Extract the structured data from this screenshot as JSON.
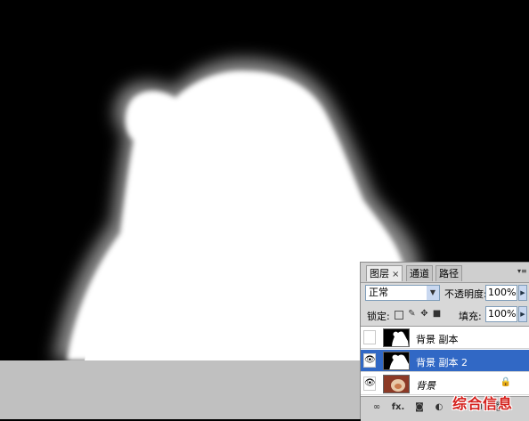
{
  "layers_panel": {
    "tabs": [
      {
        "label": "图层",
        "close": "×",
        "active": true
      },
      {
        "label": "通道",
        "active": false
      },
      {
        "label": "路径",
        "active": false
      }
    ],
    "blend_mode": "正常",
    "opacity_label": "不透明度:",
    "opacity_value": "100%",
    "lock_label": "锁定:",
    "fill_label": "填充:",
    "fill_value": "100%",
    "layers": [
      {
        "name": "背景 副本",
        "visible": false,
        "selected": false
      },
      {
        "name": "背景 副本 2",
        "visible": true,
        "selected": true
      },
      {
        "name": "背景",
        "visible": true,
        "selected": false,
        "locked": true,
        "italic": true
      }
    ]
  },
  "icons": {
    "eye": "eye-icon",
    "lock": "lock-icon",
    "link": "link-icon",
    "fx": "fx-icon",
    "mask": "mask-icon",
    "adjustment": "adjustment-icon",
    "group": "group-folder-icon",
    "new_layer": "new-layer-icon",
    "delete": "trash-icon"
  },
  "footer": {
    "fx_label": "fx."
  },
  "watermark": "综合信息",
  "colors": {
    "selected_row": "#3168c5",
    "canvas_bg": "#000000",
    "watermark": "#d4201c"
  }
}
